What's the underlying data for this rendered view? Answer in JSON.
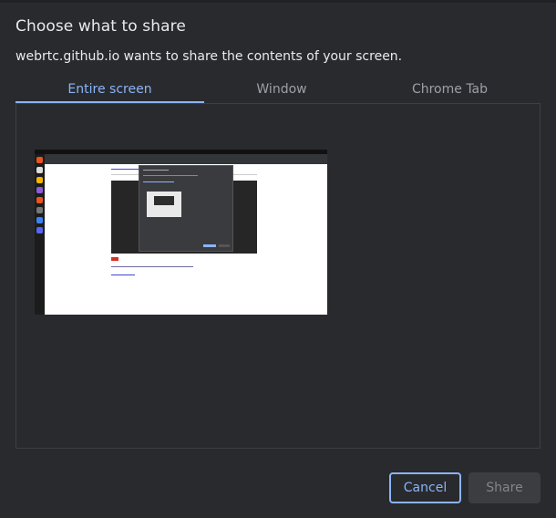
{
  "dialog": {
    "title": "Choose what to share",
    "subtitle": "webrtc.github.io wants to share the contents of your screen."
  },
  "tabs": [
    {
      "label": "Entire screen",
      "active": true
    },
    {
      "label": "Window",
      "active": false
    },
    {
      "label": "Chrome Tab",
      "active": false
    }
  ],
  "sources": [
    {
      "type": "screen",
      "selected": false
    }
  ],
  "buttons": {
    "cancel_label": "Cancel",
    "share_label": "Share",
    "share_enabled": false
  },
  "colors": {
    "accent": "#8ab4f8",
    "background": "#292a2d",
    "text": "#e8eaed",
    "muted_text": "#9aa0a6"
  }
}
